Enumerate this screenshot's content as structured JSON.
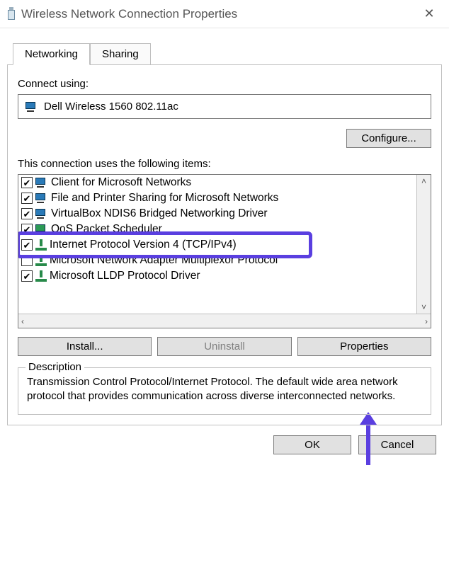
{
  "window": {
    "title": "Wireless Network Connection Properties"
  },
  "tabs": {
    "networking": "Networking",
    "sharing": "Sharing"
  },
  "connect_using_label": "Connect using:",
  "adapter_name": "Dell Wireless 1560 802.11ac",
  "configure_label": "Configure...",
  "items_label": "This connection uses the following items:",
  "items": [
    {
      "checked": true,
      "icon": "net",
      "label": "Client for Microsoft Networks"
    },
    {
      "checked": true,
      "icon": "net",
      "label": "File and Printer Sharing for Microsoft Networks"
    },
    {
      "checked": true,
      "icon": "net",
      "label": "VirtualBox NDIS6 Bridged Networking Driver"
    },
    {
      "checked": true,
      "icon": "bridge",
      "label": "QoS Packet Scheduler"
    },
    {
      "checked": true,
      "icon": "proto",
      "label": "Internet Protocol Version 4 (TCP/IPv4)"
    },
    {
      "checked": false,
      "icon": "proto",
      "label": "Microsoft Network Adapter Multiplexor Protocol"
    },
    {
      "checked": true,
      "icon": "proto",
      "label": "Microsoft LLDP Protocol Driver"
    }
  ],
  "buttons": {
    "install": "Install...",
    "uninstall": "Uninstall",
    "properties": "Properties",
    "ok": "OK",
    "cancel": "Cancel"
  },
  "description": {
    "legend": "Description",
    "text": "Transmission Control Protocol/Internet Protocol. The default wide area network protocol that provides communication across diverse interconnected networks."
  },
  "annotation": {
    "highlight_item_index": 4,
    "highlight_color": "#5a3fe0"
  }
}
